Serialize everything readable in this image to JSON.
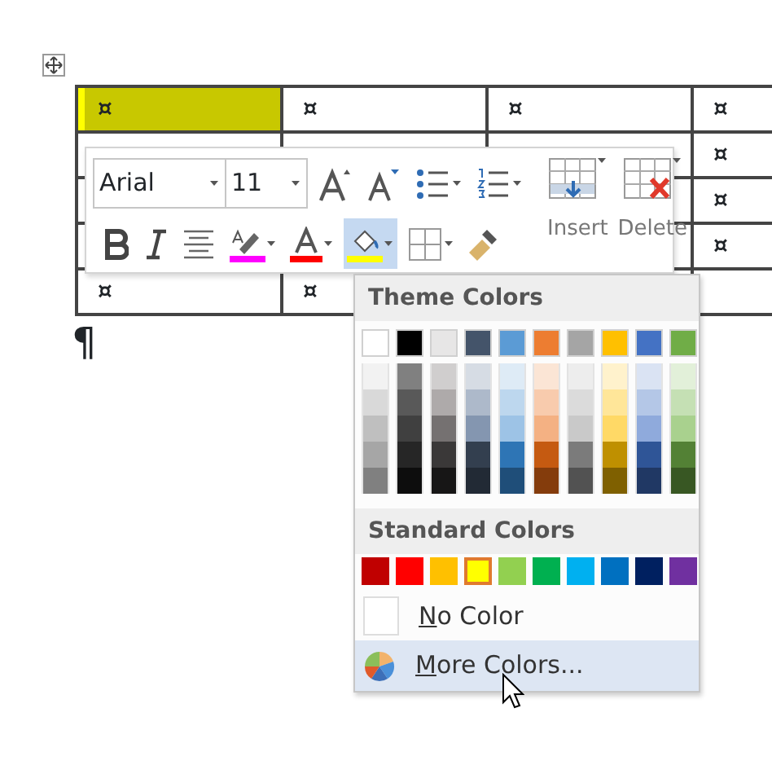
{
  "table": {
    "rows": [
      {
        "cells": [
          {
            "text": "¤",
            "selected": true
          },
          {
            "text": "¤",
            "selected": false
          },
          {
            "text": "¤",
            "selected": false
          },
          {
            "text": "¤",
            "selected": false
          }
        ]
      },
      {
        "cells": [
          null,
          null,
          null,
          {
            "text": "¤",
            "selected": false
          }
        ]
      },
      {
        "cells": [
          null,
          null,
          null,
          {
            "text": "¤",
            "selected": false
          }
        ]
      },
      {
        "cells": [
          null,
          null,
          null,
          {
            "text": "¤",
            "selected": false
          }
        ]
      },
      {
        "cells": [
          {
            "text": "¤",
            "selected": false
          },
          {
            "text": "¤",
            "selected": false
          },
          null,
          null
        ]
      }
    ]
  },
  "paragraph_mark": "¶",
  "mini_toolbar": {
    "font": {
      "value": "Arial"
    },
    "size": {
      "value": "11"
    },
    "row_1": [
      {
        "kind": "grow",
        "selected": false
      },
      {
        "kind": "shrink",
        "selected": false
      },
      {
        "kind": "bullets",
        "selected": false
      },
      {
        "kind": "numbering",
        "selected": false
      }
    ],
    "row_2": [
      {
        "kind": "bold",
        "selected": false
      },
      {
        "kind": "italic",
        "selected": false
      },
      {
        "kind": "center",
        "selected": false
      },
      {
        "kind": "highlight",
        "selected": false
      },
      {
        "kind": "fontcolor",
        "selected": false
      },
      {
        "kind": "shading",
        "selected": true
      },
      {
        "kind": "borders",
        "selected": false
      },
      {
        "kind": "painter",
        "selected": false
      }
    ],
    "insert": {
      "label": "Insert"
    },
    "delete": {
      "label": "Delete"
    }
  },
  "color_menu": {
    "theme_title": "Theme Colors",
    "theme_colors": [
      {
        "color": "#ffffff",
        "shades": [
          {
            "color": "#f2f2f2"
          },
          {
            "color": "#d9d9d9"
          },
          {
            "color": "#bfbfbf"
          },
          {
            "color": "#a6a6a6"
          },
          {
            "color": "#808080"
          }
        ]
      },
      {
        "color": "#000000",
        "shades": [
          {
            "color": "#808080"
          },
          {
            "color": "#595959"
          },
          {
            "color": "#404040"
          },
          {
            "color": "#262626"
          },
          {
            "color": "#0d0d0d"
          }
        ]
      },
      {
        "color": "#e7e6e6",
        "shades": [
          {
            "color": "#d0cece"
          },
          {
            "color": "#aeaaaa"
          },
          {
            "color": "#757171"
          },
          {
            "color": "#3a3838"
          },
          {
            "color": "#171616"
          }
        ]
      },
      {
        "color": "#44546a",
        "shades": [
          {
            "color": "#d6dce4"
          },
          {
            "color": "#adb9ca"
          },
          {
            "color": "#8496b0"
          },
          {
            "color": "#333f4f"
          },
          {
            "color": "#222a35"
          }
        ]
      },
      {
        "color": "#5b9bd5",
        "shades": [
          {
            "color": "#deebf6"
          },
          {
            "color": "#bdd7ee"
          },
          {
            "color": "#9dc3e6"
          },
          {
            "color": "#2e75b5"
          },
          {
            "color": "#1f4e79"
          }
        ]
      },
      {
        "color": "#ed7d31",
        "shades": [
          {
            "color": "#fbe5d5"
          },
          {
            "color": "#f8cbad"
          },
          {
            "color": "#f4b183"
          },
          {
            "color": "#c55a11"
          },
          {
            "color": "#843c0c"
          }
        ]
      },
      {
        "color": "#a5a5a5",
        "shades": [
          {
            "color": "#ededed"
          },
          {
            "color": "#dbdbdb"
          },
          {
            "color": "#c9c9c9"
          },
          {
            "color": "#7b7b7b"
          },
          {
            "color": "#525252"
          }
        ]
      },
      {
        "color": "#ffc000",
        "shades": [
          {
            "color": "#fff2cc"
          },
          {
            "color": "#ffe699"
          },
          {
            "color": "#ffd966"
          },
          {
            "color": "#bf9000"
          },
          {
            "color": "#7f6000"
          }
        ]
      },
      {
        "color": "#4472c4",
        "shades": [
          {
            "color": "#dae3f3"
          },
          {
            "color": "#b4c7e7"
          },
          {
            "color": "#8faadc"
          },
          {
            "color": "#2f5597"
          },
          {
            "color": "#203864"
          }
        ]
      },
      {
        "color": "#70ad47",
        "shades": [
          {
            "color": "#e2f0d9"
          },
          {
            "color": "#c5e0b4"
          },
          {
            "color": "#a9d18e"
          },
          {
            "color": "#538135"
          },
          {
            "color": "#385723"
          }
        ]
      }
    ],
    "standard_title": "Standard Colors",
    "standard_colors": [
      {
        "color": "#c00000",
        "selected": false
      },
      {
        "color": "#ff0000",
        "selected": false
      },
      {
        "color": "#ffc000",
        "selected": false
      },
      {
        "color": "#ffff00",
        "selected": true
      },
      {
        "color": "#92d050",
        "selected": false
      },
      {
        "color": "#00b050",
        "selected": false
      },
      {
        "color": "#00b0f0",
        "selected": false
      },
      {
        "color": "#0070c0",
        "selected": false
      },
      {
        "color": "#002060",
        "selected": false
      },
      {
        "color": "#7030a0",
        "selected": false
      }
    ],
    "items": [
      {
        "kind": "nocolor",
        "access_key": "N",
        "label": "o Color",
        "selected": false
      },
      {
        "kind": "more",
        "access_key": "M",
        "label": "ore Colors...",
        "selected": true
      }
    ]
  }
}
